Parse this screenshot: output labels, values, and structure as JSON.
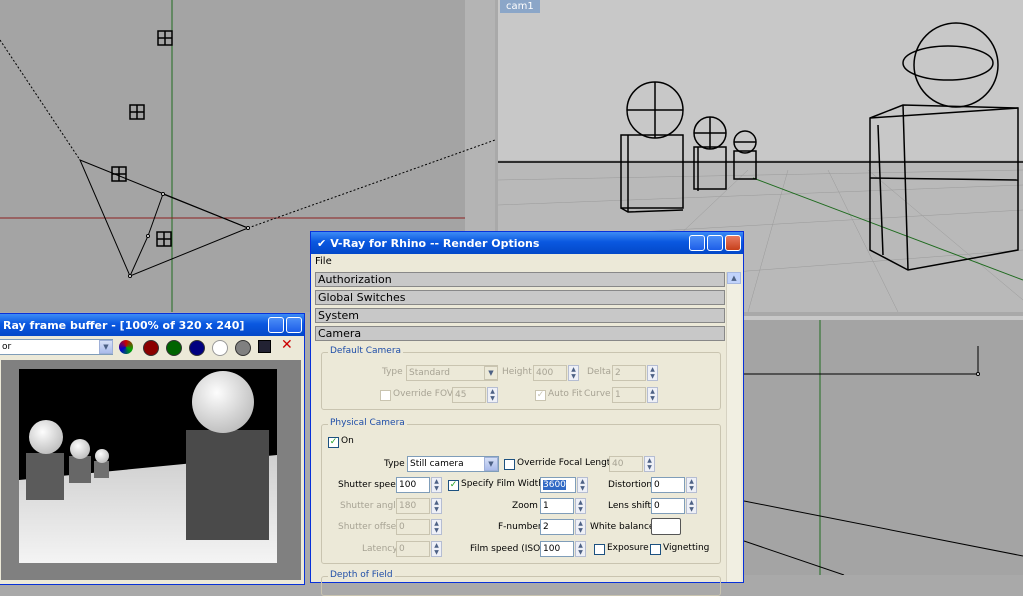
{
  "viewports": {
    "cam_label": "cam1"
  },
  "vfb": {
    "title": "Ray frame buffer - [100% of 320 x 240]",
    "channel": "or",
    "swatch_colors": [
      "#8b0000",
      "#006400",
      "#000080",
      "#ffffff",
      "#808080"
    ]
  },
  "render": {
    "title": "V-Ray for Rhino -- Render Options",
    "menu": "File",
    "rollouts": [
      "Authorization",
      "Global Switches",
      "System",
      "Camera"
    ],
    "default_camera": {
      "title": "Default Camera",
      "type_label": "Type",
      "type_value": "Standard",
      "height_label": "Height",
      "height_value": "400",
      "delta_label": "Delta",
      "delta_value": "2",
      "override_fov_label": "Override FOV",
      "override_fov_value": "45",
      "auto_fit_label": "Auto Fit",
      "curve_label": "Curve",
      "curve_value": "1"
    },
    "physical_camera": {
      "title": "Physical Camera",
      "on_label": "On",
      "type_label": "Type",
      "type_value": "Still camera",
      "override_focal_label": "Override Focal Length",
      "override_focal_value": "40",
      "shutter_speed_label": "Shutter speed",
      "shutter_speed_value": "100",
      "specify_film_label": "Specify Film Width",
      "film_width_value": "3600",
      "distortion_label": "Distortion",
      "distortion_value": "0",
      "shutter_angle_label": "Shutter angle",
      "shutter_angle_value": "180",
      "zoom_label": "Zoom",
      "zoom_value": "1",
      "lens_shift_label": "Lens shift",
      "lens_shift_value": "0",
      "shutter_offset_label": "Shutter offset",
      "shutter_offset_value": "0",
      "fnumber_label": "F-number",
      "fnumber_value": "2",
      "white_balance_label": "White balance",
      "latency_label": "Latency",
      "latency_value": "0",
      "film_speed_label": "Film speed (ISO)",
      "film_speed_value": "100",
      "exposure_label": "Exposure",
      "vignetting_label": "Vignetting"
    },
    "dof_title": "Depth of Field"
  }
}
